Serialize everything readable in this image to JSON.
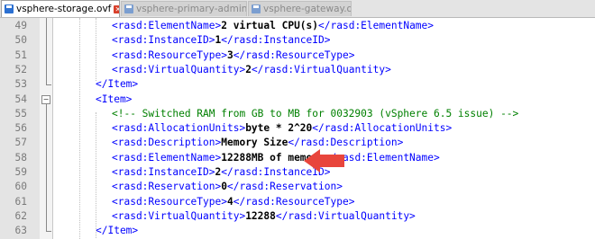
{
  "tabs": [
    {
      "label": "vsphere-storage.ovf",
      "active": true
    },
    {
      "label": "vsphere-primary-admin.ovf",
      "active": false
    },
    {
      "label": "vsphere-gateway.ovf",
      "active": false
    }
  ],
  "lines": [
    {
      "num": "49",
      "parts": [
        [
          "tag",
          "<rasd:ElementName>"
        ],
        [
          "txt",
          "2 virtual CPU(s)"
        ],
        [
          "tag",
          "</rasd:ElementName>"
        ]
      ]
    },
    {
      "num": "50",
      "parts": [
        [
          "tag",
          "<rasd:InstanceID>"
        ],
        [
          "txt",
          "1"
        ],
        [
          "tag",
          "</rasd:InstanceID>"
        ]
      ]
    },
    {
      "num": "51",
      "parts": [
        [
          "tag",
          "<rasd:ResourceType>"
        ],
        [
          "txt",
          "3"
        ],
        [
          "tag",
          "</rasd:ResourceType>"
        ]
      ]
    },
    {
      "num": "52",
      "parts": [
        [
          "tag",
          "<rasd:VirtualQuantity>"
        ],
        [
          "txt",
          "2"
        ],
        [
          "tag",
          "</rasd:VirtualQuantity>"
        ]
      ]
    },
    {
      "num": "53",
      "parts": [
        [
          "tag",
          "</Item>"
        ]
      ]
    },
    {
      "num": "54",
      "parts": [
        [
          "tag",
          "<Item>"
        ]
      ]
    },
    {
      "num": "55",
      "parts": [
        [
          "cmt",
          "<!-- Switched RAM from GB to MB for 0032903 (vSphere 6.5 issue) -->"
        ]
      ]
    },
    {
      "num": "56",
      "parts": [
        [
          "tag",
          "<rasd:AllocationUnits>"
        ],
        [
          "txt",
          "byte * 2^20"
        ],
        [
          "tag",
          "</rasd:AllocationUnits>"
        ]
      ]
    },
    {
      "num": "57",
      "parts": [
        [
          "tag",
          "<rasd:Description>"
        ],
        [
          "txt",
          "Memory Size"
        ],
        [
          "tag",
          "</rasd:Description>"
        ]
      ]
    },
    {
      "num": "58",
      "parts": [
        [
          "tag",
          "<rasd:ElementName>"
        ],
        [
          "txt",
          "12288MB of memory"
        ],
        [
          "tag",
          "</rasd:ElementName>"
        ]
      ]
    },
    {
      "num": "59",
      "parts": [
        [
          "tag",
          "<rasd:InstanceID>"
        ],
        [
          "txt",
          "2"
        ],
        [
          "tag",
          "</rasd:InstanceID>"
        ]
      ]
    },
    {
      "num": "60",
      "parts": [
        [
          "tag",
          "<rasd:Reservation>"
        ],
        [
          "txt",
          "0"
        ],
        [
          "tag",
          "</rasd:Reservation>"
        ]
      ]
    },
    {
      "num": "61",
      "parts": [
        [
          "tag",
          "<rasd:ResourceType>"
        ],
        [
          "txt",
          "4"
        ],
        [
          "tag",
          "</rasd:ResourceType>"
        ]
      ]
    },
    {
      "num": "62",
      "parts": [
        [
          "tag",
          "<rasd:VirtualQuantity>"
        ],
        [
          "txt",
          "12288"
        ],
        [
          "tag",
          "</rasd:VirtualQuantity>"
        ]
      ]
    },
    {
      "num": "63",
      "parts": [
        [
          "tag",
          "</Item>"
        ]
      ]
    }
  ],
  "colors": {
    "tag": "#0000ff",
    "text": "#000000",
    "comment": "#008000",
    "arrow": "#e8453c"
  }
}
